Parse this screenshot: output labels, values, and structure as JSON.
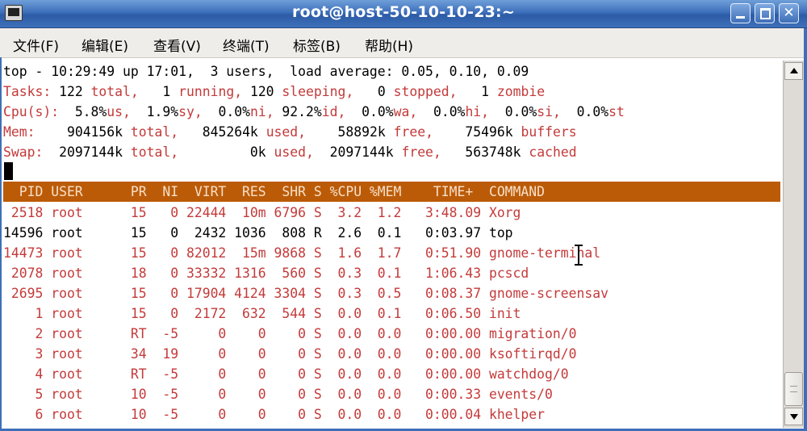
{
  "window": {
    "title": "root@host-50-10-10-23:~",
    "close_glyph": "✕"
  },
  "menu": [
    "文件(F)",
    "编辑(E)",
    "查看(V)",
    "终端(T)",
    "标签(B)",
    "帮助(H)"
  ],
  "summary": {
    "top_line": "top - 10:29:49 up 17:01,  3 users,  load average: 0.05, 0.10, 0.09",
    "tasks": [
      {
        "t": "Tasks:",
        "c": "red"
      },
      {
        "t": " 122 ",
        "c": "blk"
      },
      {
        "t": "total,",
        "c": "red"
      },
      {
        "t": "   1 ",
        "c": "blk"
      },
      {
        "t": "running,",
        "c": "red"
      },
      {
        "t": " 120 ",
        "c": "blk"
      },
      {
        "t": "sleeping,",
        "c": "red"
      },
      {
        "t": "   0 ",
        "c": "blk"
      },
      {
        "t": "stopped,",
        "c": "red"
      },
      {
        "t": "   1 ",
        "c": "blk"
      },
      {
        "t": "zombie",
        "c": "red"
      }
    ],
    "cpu": [
      {
        "t": "Cpu(s):",
        "c": "red"
      },
      {
        "t": "  5.8%",
        "c": "blk"
      },
      {
        "t": "us,",
        "c": "red"
      },
      {
        "t": "  1.9%",
        "c": "blk"
      },
      {
        "t": "sy,",
        "c": "red"
      },
      {
        "t": "  0.0%",
        "c": "blk"
      },
      {
        "t": "ni,",
        "c": "red"
      },
      {
        "t": " 92.2%",
        "c": "blk"
      },
      {
        "t": "id,",
        "c": "red"
      },
      {
        "t": "  0.0%",
        "c": "blk"
      },
      {
        "t": "wa,",
        "c": "red"
      },
      {
        "t": "  0.0%",
        "c": "blk"
      },
      {
        "t": "hi,",
        "c": "red"
      },
      {
        "t": "  0.0%",
        "c": "blk"
      },
      {
        "t": "si,",
        "c": "red"
      },
      {
        "t": "  0.0%",
        "c": "blk"
      },
      {
        "t": "st",
        "c": "red"
      }
    ],
    "mem": [
      {
        "t": "Mem:",
        "c": "red"
      },
      {
        "t": "    904156k ",
        "c": "blk"
      },
      {
        "t": "total,",
        "c": "red"
      },
      {
        "t": "   845264k ",
        "c": "blk"
      },
      {
        "t": "used,",
        "c": "red"
      },
      {
        "t": "    58892k ",
        "c": "blk"
      },
      {
        "t": "free,",
        "c": "red"
      },
      {
        "t": "    75496k ",
        "c": "blk"
      },
      {
        "t": "buffers",
        "c": "red"
      }
    ],
    "swap": [
      {
        "t": "Swap:",
        "c": "red"
      },
      {
        "t": "  2097144k ",
        "c": "blk"
      },
      {
        "t": "total,",
        "c": "red"
      },
      {
        "t": "         0k ",
        "c": "blk"
      },
      {
        "t": "used,",
        "c": "red"
      },
      {
        "t": "  2097144k ",
        "c": "blk"
      },
      {
        "t": "free,",
        "c": "red"
      },
      {
        "t": "   563748k ",
        "c": "blk"
      },
      {
        "t": "cached",
        "c": "red"
      }
    ]
  },
  "process_table": {
    "header": "  PID USER      PR  NI  VIRT  RES  SHR S %CPU %MEM    TIME+  COMMAND",
    "rows": [
      {
        "line": " 2518 root      15   0 22444  10m 6796 S  3.2  1.2   3:48.09 Xorg",
        "color": "red"
      },
      {
        "line": "14596 root      15   0  2432 1036  808 R  2.6  0.1   0:03.97 top",
        "color": "blk"
      },
      {
        "line": "14473 root      15   0 82012  15m 9868 S  1.6  1.7   0:51.90 gnome-terminal",
        "color": "red"
      },
      {
        "line": " 2078 root      18   0 33332 1316  560 S  0.3  0.1   1:06.43 pcscd",
        "color": "red"
      },
      {
        "line": " 2695 root      15   0 17904 4124 3304 S  0.3  0.5   0:08.37 gnome-screensav",
        "color": "red"
      },
      {
        "line": "    1 root      15   0  2172  632  544 S  0.0  0.1   0:06.50 init",
        "color": "red"
      },
      {
        "line": "    2 root      RT  -5     0    0    0 S  0.0  0.0   0:00.00 migration/0",
        "color": "red"
      },
      {
        "line": "    3 root      34  19     0    0    0 S  0.0  0.0   0:00.00 ksoftirqd/0",
        "color": "red"
      },
      {
        "line": "    4 root      RT  -5     0    0    0 S  0.0  0.0   0:00.00 watchdog/0",
        "color": "red"
      },
      {
        "line": "    5 root      10  -5     0    0    0 S  0.0  0.0   0:00.33 events/0",
        "color": "red"
      },
      {
        "line": "    6 root      10  -5     0    0    0 S  0.0  0.0   0:00.04 khelper",
        "color": "red"
      }
    ]
  },
  "colors": {
    "titlebar": "#3d6fbb",
    "header_bg": "#bb5b08",
    "text_red": "#c43a3a"
  }
}
